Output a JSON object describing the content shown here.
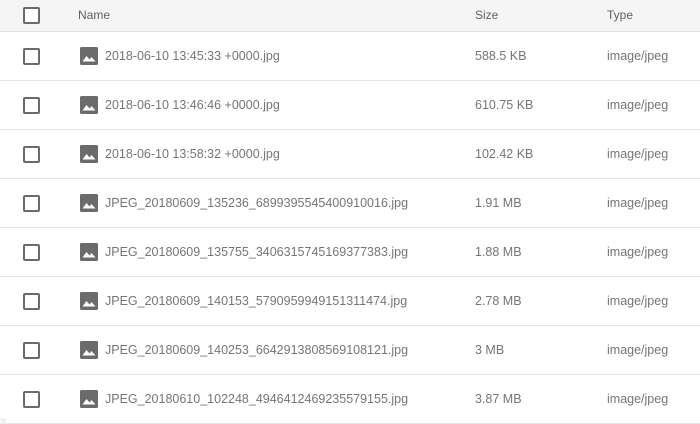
{
  "header": {
    "name_label": "Name",
    "size_label": "Size",
    "type_label": "Type"
  },
  "icons": {
    "file": "image-file-icon",
    "checkbox": "checkbox-icon"
  },
  "colors": {
    "header_bg": "#f5f5f5",
    "icon": "#6b6b6b",
    "text": "#757575"
  },
  "rows": [
    {
      "name": "2018-06-10 13:45:33 +0000.jpg",
      "size": "588.5 KB",
      "type": "image/jpeg"
    },
    {
      "name": "2018-06-10 13:46:46 +0000.jpg",
      "size": "610.75 KB",
      "type": "image/jpeg"
    },
    {
      "name": "2018-06-10 13:58:32 +0000.jpg",
      "size": "102.42 KB",
      "type": "image/jpeg"
    },
    {
      "name": "JPEG_20180609_135236_6899395545400910016.jpg",
      "size": "1.91 MB",
      "type": "image/jpeg"
    },
    {
      "name": "JPEG_20180609_135755_3406315745169377383.jpg",
      "size": "1.88 MB",
      "type": "image/jpeg"
    },
    {
      "name": "JPEG_20180609_140153_5790959949151311474.jpg",
      "size": "2.78 MB",
      "type": "image/jpeg"
    },
    {
      "name": "JPEG_20180609_140253_6642913808569108121.jpg",
      "size": "3 MB",
      "type": "image/jpeg"
    },
    {
      "name": "JPEG_20180610_102248_4946412469235579155.jpg",
      "size": "3.87 MB",
      "type": "image/jpeg"
    }
  ]
}
